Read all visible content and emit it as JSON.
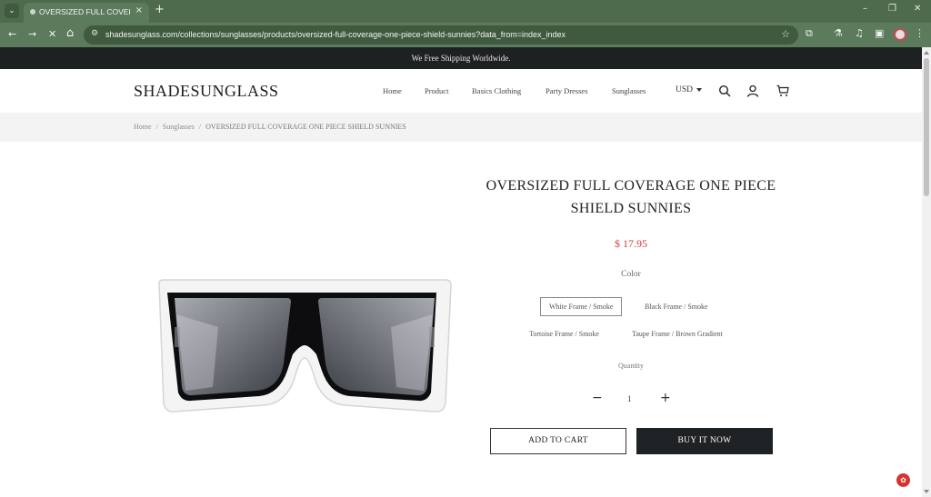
{
  "browser": {
    "tab_title": "OVERSIZED FULL COVERAGE O",
    "tab_close": "×",
    "new_tab": "+",
    "url": "shadesunglass.com/collections/sunglasses/products/oversized-full-coverage-one-piece-shield-sunnies?data_from=index_index",
    "window_controls": {
      "minimize": "–",
      "restore": "❐",
      "close": "✕"
    },
    "nav": {
      "back": "←",
      "forward": "→",
      "reload": "✕",
      "home": "⌂"
    },
    "star": "☆"
  },
  "announcement": "We Free Shipping Worldwide.",
  "header": {
    "logo": "SHADESUNGLASS",
    "nav": [
      "Home",
      "Product",
      "Basics Clothing",
      "Party Dresses",
      "Sunglasses"
    ],
    "currency": "USD",
    "icons": [
      "search-icon",
      "account-icon",
      "cart-icon"
    ]
  },
  "breadcrumbs": [
    "Home",
    "Sunglasses",
    "OVERSIZED FULL COVERAGE ONE PIECE SHIELD SUNNIES"
  ],
  "product": {
    "title_line1": "OVERSIZED FULL COVERAGE ONE PIECE",
    "title_line2": "SHIELD SUNNIES",
    "price": "$ 17.95",
    "color_label": "Color",
    "colors": [
      "White Frame / Smoke",
      "Black Frame / Smoke",
      "Tortoise Frame / Smoke",
      "Taupe Frame / Brown Gradient"
    ],
    "selected_color": "White Frame / Smoke",
    "quantity_label": "Quantity",
    "quantity": "1",
    "add_to_cart": "ADD TO CART",
    "buy_now": "BUY IT NOW"
  },
  "colors": {
    "announcement_bg": "#1e2122",
    "price": "#d23a3a",
    "buy_button_bg": "#1f2224",
    "browser_frame": "#5c7a5c"
  }
}
